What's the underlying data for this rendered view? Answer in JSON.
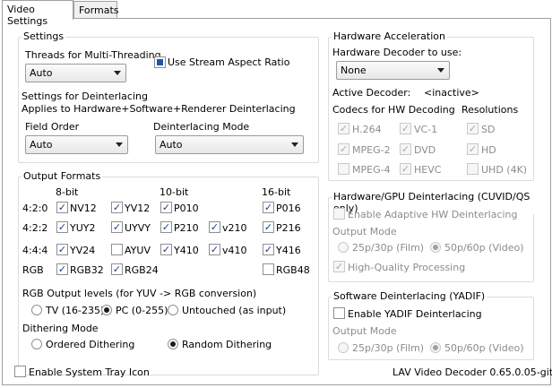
{
  "tabs": [
    "Video Settings",
    "Formats"
  ],
  "settings": {
    "title": "Settings",
    "threads_label": "Threads for Multi-Threading",
    "threads_value": "Auto",
    "stream_aspect_label": "Use Stream Aspect Ratio",
    "deint_settings_label": "Settings for Deinterlacing",
    "deint_note": "Applies to Hardware+Software+Renderer Deinterlacing",
    "field_order_label": "Field Order",
    "field_order_value": "Auto",
    "deint_mode_label": "Deinterlacing Mode",
    "deint_mode_value": "Auto"
  },
  "output": {
    "title": "Output Formats",
    "col_8bit": "8-bit",
    "col_10bit": "10-bit",
    "col_16bit": "16-bit",
    "row_420": "4:2:0",
    "row_422": "4:2:2",
    "row_444": "4:4:4",
    "row_rgb": "RGB",
    "fmt": {
      "nv12": "NV12",
      "yv12": "YV12",
      "p010": "P010",
      "p016": "P016",
      "yuy2": "YUY2",
      "uyvy": "UYVY",
      "p210": "P210",
      "v210": "v210",
      "p216": "P216",
      "yv24": "YV24",
      "ayuv": "AYUV",
      "y410": "Y410",
      "v410": "v410",
      "y416": "Y416",
      "rgb32": "RGB32",
      "rgb24": "RGB24",
      "rgb48": "RGB48"
    },
    "rgb_levels_label": "RGB Output levels (for YUV -> RGB conversion)",
    "tv_label": "TV (16-235)",
    "pc_label": "PC (0-255)",
    "untouched_label": "Untouched (as input)",
    "dithering_label": "Dithering Mode",
    "ordered_label": "Ordered Dithering",
    "random_label": "Random Dithering"
  },
  "hw": {
    "title": "Hardware Acceleration",
    "decoder_label": "Hardware Decoder to use:",
    "decoder_value": "None",
    "active_label": "Active Decoder:",
    "active_value": "<inactive>",
    "codecs_label": "Codecs for HW Decoding",
    "resolutions_label": "Resolutions",
    "h264": "H.264",
    "vc1": "VC-1",
    "sd": "SD",
    "mpeg2": "MPEG-2",
    "dvd": "DVD",
    "hd": "HD",
    "mpeg4": "MPEG-4",
    "hevc": "HEVC",
    "uhd": "UHD (4K)"
  },
  "hwdeint": {
    "title": "Hardware/GPU Deinterlacing (CUVID/QS only)",
    "adaptive_label": "Enable Adaptive HW Deinterlacing",
    "output_mode_label": "Output Mode",
    "film_label": "25p/30p (Film)",
    "video_label": "50p/60p (Video)",
    "hq_label": "High-Quality Processing"
  },
  "swdeint": {
    "title": "Software Deinterlacing (YADIF)",
    "yadif_label": "Enable YADIF Deinterlacing",
    "output_mode_label": "Output Mode",
    "film_label": "25p/30p (Film)",
    "video_label": "50p/60p (Video)"
  },
  "footer": {
    "tray_label": "Enable System Tray Icon",
    "version": "LAV Video Decoder 0.65.0.05-git"
  }
}
